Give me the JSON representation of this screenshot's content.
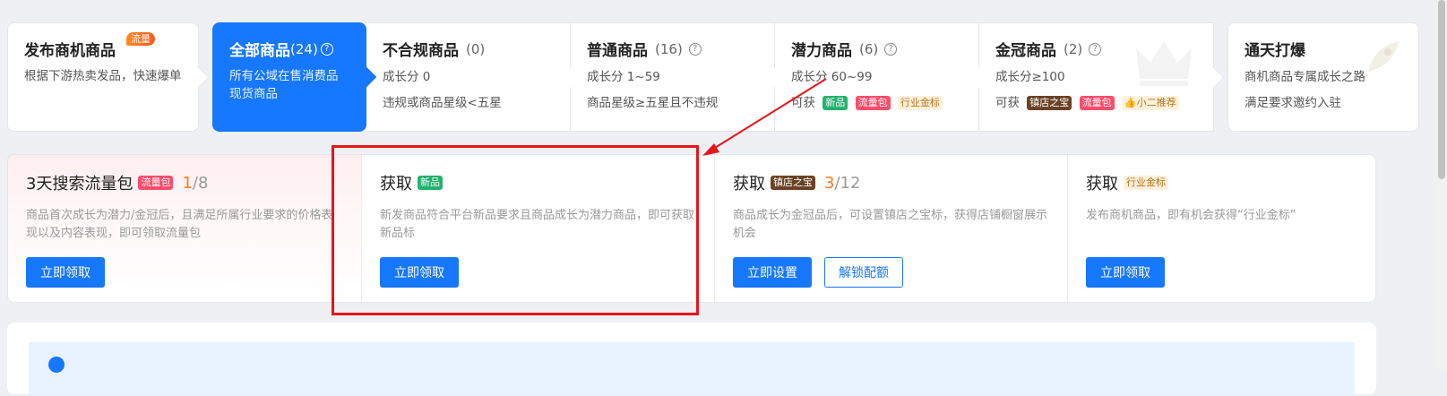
{
  "categories": [
    {
      "title": "发布商机商品",
      "hot_badge": "流量",
      "desc": "根据下游热卖发品，快速爆单"
    },
    {
      "title": "全部商品",
      "count": "(24)",
      "desc": "所有公域在售消费品现货商品"
    },
    {
      "title": "不合规商品",
      "count": "(0)",
      "line1": "成长分 0",
      "line2": "违规或商品星级<五星"
    },
    {
      "title": "普通商品",
      "count": "(16)",
      "line1": "成长分 1~59",
      "line2": "商品星级≥五星且不违规"
    },
    {
      "title": "潜力商品",
      "count": "(6)",
      "line1": "成长分 60~99",
      "line2_prefix": "可获",
      "tags": [
        "新品",
        "流量包",
        "行业金标"
      ]
    },
    {
      "title": "金冠商品",
      "count": "(2)",
      "line1": "成长分≥100",
      "line2_prefix": "可获",
      "tags": [
        "镇店之宝",
        "流量包",
        "小二推荐"
      ]
    },
    {
      "title": "通天打爆",
      "line1": "商机商品专属成长之路",
      "line2": "满足要求邀约入驻"
    }
  ],
  "benefits": [
    {
      "title": "3天搜索流量包",
      "tag": "流量包",
      "progress_current": "1",
      "progress_sep": "/",
      "progress_total": "8",
      "desc": "商品首次成长为潜力/金冠后，且满足所属行业要求的价格表现以及内容表现，即可领取流量包",
      "buttons": [
        "立即领取"
      ]
    },
    {
      "title": "获取",
      "tag": "新品",
      "desc": "新发商品符合平台新品要求且商品成长为潜力商品，即可获取新品标",
      "buttons": [
        "立即领取"
      ]
    },
    {
      "title": "获取",
      "tag": "镇店之宝",
      "progress_current": "3",
      "progress_sep": "/",
      "progress_total": "12",
      "desc": "商品成长为金冠品后，可设置镇店之宝标，获得店铺橱窗展示机会",
      "buttons": [
        "立即设置"
      ],
      "outline_button": "解锁配额"
    },
    {
      "title": "获取",
      "tag": "行业金标",
      "desc": "发布商机商品，即有机会获得“行业金标”",
      "buttons": [
        "立即领取"
      ]
    }
  ],
  "help_glyph": "?",
  "colors": {
    "primary": "#1677ff",
    "annotation": "#e8151b",
    "orange": "#ff7a1a"
  }
}
